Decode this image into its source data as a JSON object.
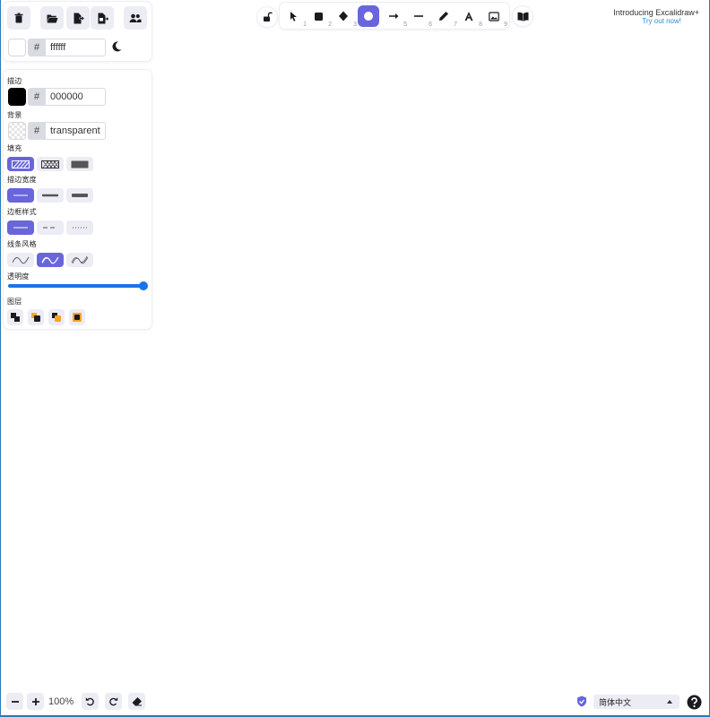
{
  "app": {
    "accent_color": "#6965db",
    "promo_title": "Introducing Excalidraw+",
    "promo_link": "Try out now!"
  },
  "top_menu": {
    "buttons": [
      {
        "name": "clear-canvas",
        "icon": "trash-icon"
      },
      {
        "name": "open",
        "icon": "folder-open-icon"
      },
      {
        "name": "save-as",
        "icon": "file-export-icon"
      },
      {
        "name": "export-image",
        "icon": "file-image-export-icon"
      },
      {
        "name": "collaborate",
        "icon": "users-icon"
      }
    ],
    "canvas_background": {
      "hash": "#",
      "value": "ffffff",
      "color": "#ffffff"
    },
    "theme_toggle_icon": "moon-icon"
  },
  "properties": {
    "stroke": {
      "label": "描边",
      "hash": "#",
      "value": "000000",
      "color": "#000000"
    },
    "background": {
      "label": "背景",
      "hash": "#",
      "value": "transparent"
    },
    "fill": {
      "label": "填充",
      "options": [
        "hachure",
        "cross-hatch",
        "solid"
      ],
      "selected": "hachure"
    },
    "stroke_width": {
      "label": "描边宽度",
      "options": [
        "thin",
        "bold",
        "extra-bold"
      ],
      "selected": "thin"
    },
    "stroke_style": {
      "label": "边框样式",
      "options": [
        "solid",
        "dashed",
        "dotted"
      ],
      "selected": "solid"
    },
    "sloppiness": {
      "label": "线条风格",
      "options": [
        "architect",
        "artist",
        "cartoonist"
      ],
      "selected": "artist"
    },
    "opacity": {
      "label": "透明度",
      "value": 100
    },
    "layers": {
      "label": "图层",
      "actions": [
        "send-to-back",
        "send-backward",
        "bring-forward",
        "bring-to-front"
      ]
    }
  },
  "toolbar": {
    "lock_icon": "unlock-icon",
    "tools": [
      {
        "name": "selection",
        "icon": "cursor-icon",
        "key": "1"
      },
      {
        "name": "rectangle",
        "icon": "square-icon",
        "key": "2"
      },
      {
        "name": "diamond",
        "icon": "diamond-icon",
        "key": "3"
      },
      {
        "name": "ellipse",
        "icon": "circle-icon",
        "key": "4",
        "active": true
      },
      {
        "name": "arrow",
        "icon": "arrow-icon",
        "key": "5"
      },
      {
        "name": "line",
        "icon": "line-icon",
        "key": "6"
      },
      {
        "name": "draw",
        "icon": "pencil-icon",
        "key": "7"
      },
      {
        "name": "text",
        "icon": "text-icon",
        "key": "8"
      },
      {
        "name": "image",
        "icon": "image-icon",
        "key": "9"
      }
    ],
    "library_icon": "book-open-icon"
  },
  "footer": {
    "zoom_out_icon": "minus-icon",
    "zoom_in_icon": "plus-icon",
    "zoom": "100%",
    "undo_icon": "undo-icon",
    "redo_icon": "redo-icon",
    "eraser_icon": "eraser-icon",
    "shield_icon": "shield-check-icon",
    "language": "简体中文",
    "help_icon": "help-circle-icon"
  }
}
